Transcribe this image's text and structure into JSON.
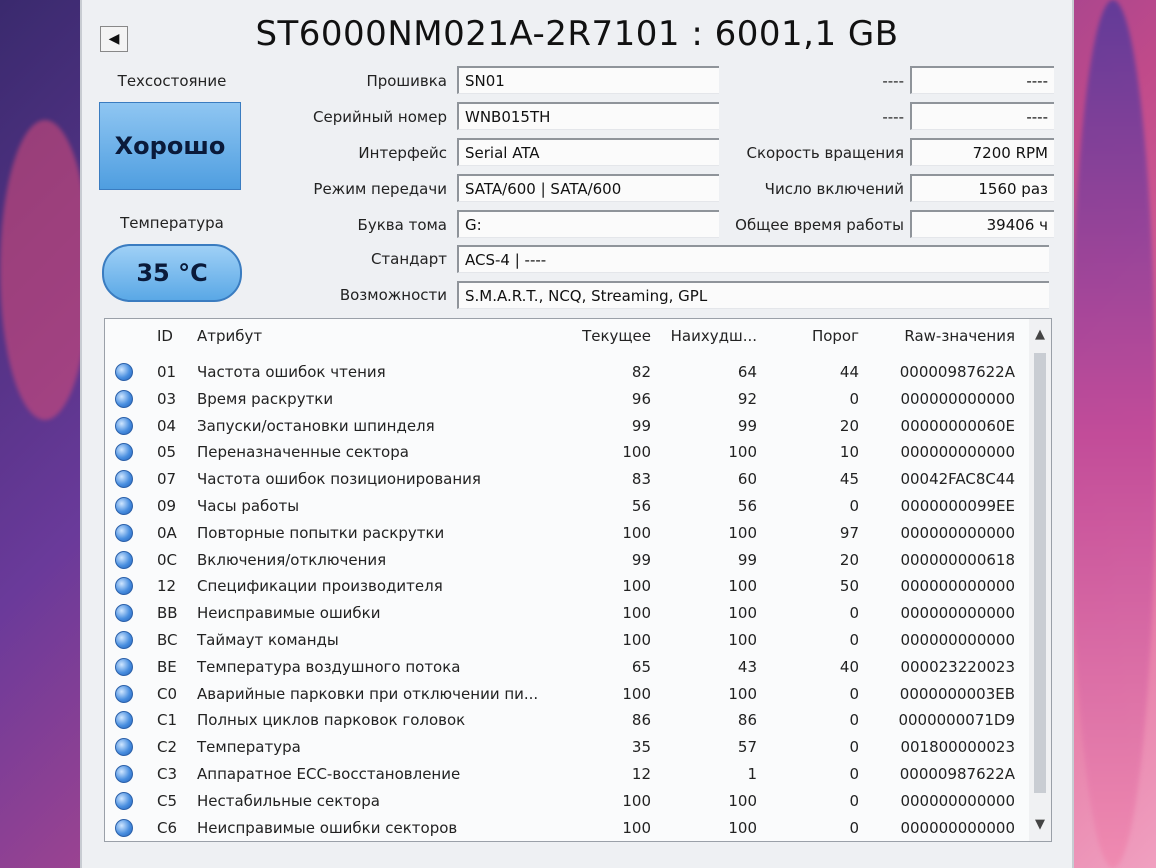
{
  "title": "ST6000NM021A-2R7101 : 6001,1 GB",
  "left": {
    "health_label": "Техсостояние",
    "health_value": "Хорошо",
    "temp_label": "Температура",
    "temp_value": "35 °C"
  },
  "info": {
    "firmware_label": "Прошивка",
    "firmware_value": "SN01",
    "serial_label": "Серийный номер",
    "serial_value": "WNB015TH",
    "interface_label": "Интерфейс",
    "interface_value": "Serial ATA",
    "transfer_label": "Режим передачи",
    "transfer_value": "SATA/600 | SATA/600",
    "drive_label": "Буква тома",
    "drive_value": "G:",
    "standard_label": "Стандарт",
    "standard_value": "ACS-4 | ----",
    "features_label": "Возможности",
    "features_value": "S.M.A.R.T., NCQ, Streaming, GPL",
    "r1_label": "----",
    "r1_value": "----",
    "r2_label": "----",
    "r2_value": "----",
    "rpm_label": "Скорость вращения",
    "rpm_value": "7200 RPM",
    "power_count_label": "Число включений",
    "power_count_value": "1560 раз",
    "power_hours_label": "Общее время работы",
    "power_hours_value": "39406 ч"
  },
  "table": {
    "headers": {
      "id": "ID",
      "attr": "Атрибут",
      "cur": "Текущее",
      "worst": "Наихудш...",
      "thr": "Порог",
      "raw": "Raw-значения"
    },
    "rows": [
      {
        "id": "01",
        "attr": "Частота ошибок чтения",
        "cur": "82",
        "worst": "64",
        "thr": "44",
        "raw": "00000987622A"
      },
      {
        "id": "03",
        "attr": "Время раскрутки",
        "cur": "96",
        "worst": "92",
        "thr": "0",
        "raw": "000000000000"
      },
      {
        "id": "04",
        "attr": "Запуски/остановки шпинделя",
        "cur": "99",
        "worst": "99",
        "thr": "20",
        "raw": "00000000060E"
      },
      {
        "id": "05",
        "attr": "Переназначенные сектора",
        "cur": "100",
        "worst": "100",
        "thr": "10",
        "raw": "000000000000"
      },
      {
        "id": "07",
        "attr": "Частота ошибок позиционирования",
        "cur": "83",
        "worst": "60",
        "thr": "45",
        "raw": "00042FAC8C44"
      },
      {
        "id": "09",
        "attr": "Часы работы",
        "cur": "56",
        "worst": "56",
        "thr": "0",
        "raw": "0000000099EE"
      },
      {
        "id": "0A",
        "attr": "Повторные попытки раскрутки",
        "cur": "100",
        "worst": "100",
        "thr": "97",
        "raw": "000000000000"
      },
      {
        "id": "0C",
        "attr": "Включения/отключения",
        "cur": "99",
        "worst": "99",
        "thr": "20",
        "raw": "000000000618"
      },
      {
        "id": "12",
        "attr": "Спецификации производителя",
        "cur": "100",
        "worst": "100",
        "thr": "50",
        "raw": "000000000000"
      },
      {
        "id": "BB",
        "attr": "Неисправимые ошибки",
        "cur": "100",
        "worst": "100",
        "thr": "0",
        "raw": "000000000000"
      },
      {
        "id": "BC",
        "attr": "Таймаут команды",
        "cur": "100",
        "worst": "100",
        "thr": "0",
        "raw": "000000000000"
      },
      {
        "id": "BE",
        "attr": "Температура воздушного потока",
        "cur": "65",
        "worst": "43",
        "thr": "40",
        "raw": "000023220023"
      },
      {
        "id": "C0",
        "attr": "Аварийные парковки при отключении пи...",
        "cur": "100",
        "worst": "100",
        "thr": "0",
        "raw": "0000000003EB"
      },
      {
        "id": "C1",
        "attr": "Полных циклов парковок головок",
        "cur": "86",
        "worst": "86",
        "thr": "0",
        "raw": "0000000071D9"
      },
      {
        "id": "C2",
        "attr": "Температура",
        "cur": "35",
        "worst": "57",
        "thr": "0",
        "raw": "001800000023"
      },
      {
        "id": "C3",
        "attr": "Аппаратное ECC-восстановление",
        "cur": "12",
        "worst": "1",
        "thr": "0",
        "raw": "00000987622A"
      },
      {
        "id": "C5",
        "attr": "Нестабильные сектора",
        "cur": "100",
        "worst": "100",
        "thr": "0",
        "raw": "000000000000"
      },
      {
        "id": "C6",
        "attr": "Неисправимые ошибки секторов",
        "cur": "100",
        "worst": "100",
        "thr": "0",
        "raw": "000000000000"
      }
    ]
  },
  "icons": {
    "back": "back-arrow-icon",
    "status": "status-dot-icon",
    "scroll_up": "chevron-up-icon",
    "scroll_down": "chevron-down-icon"
  }
}
